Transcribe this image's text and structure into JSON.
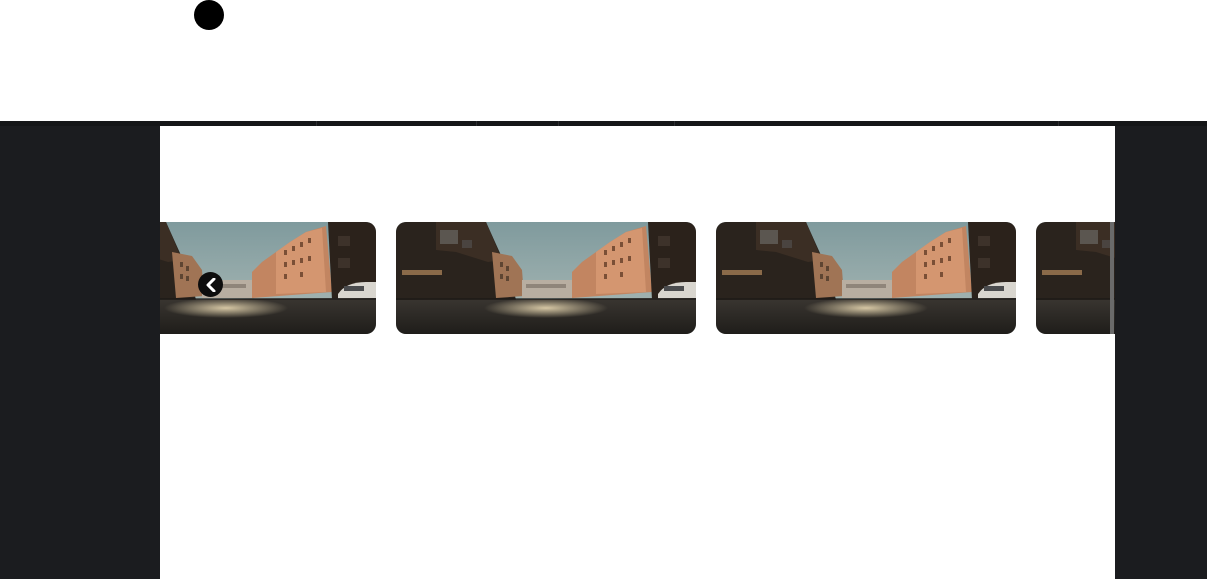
{
  "header": {
    "indicator_icon": "filled-circle-icon"
  },
  "carousel": {
    "prev_icon": "chevron-left-icon",
    "slide_image": "city-street-photo",
    "slides": [
      {
        "id": "slide-1"
      },
      {
        "id": "slide-2"
      },
      {
        "id": "slide-3"
      },
      {
        "id": "slide-4"
      }
    ]
  },
  "colors": {
    "background": "#ffffff",
    "side_panel": "#1b1c1f",
    "divider": "#151618",
    "arrow": "#0d0d0d"
  }
}
